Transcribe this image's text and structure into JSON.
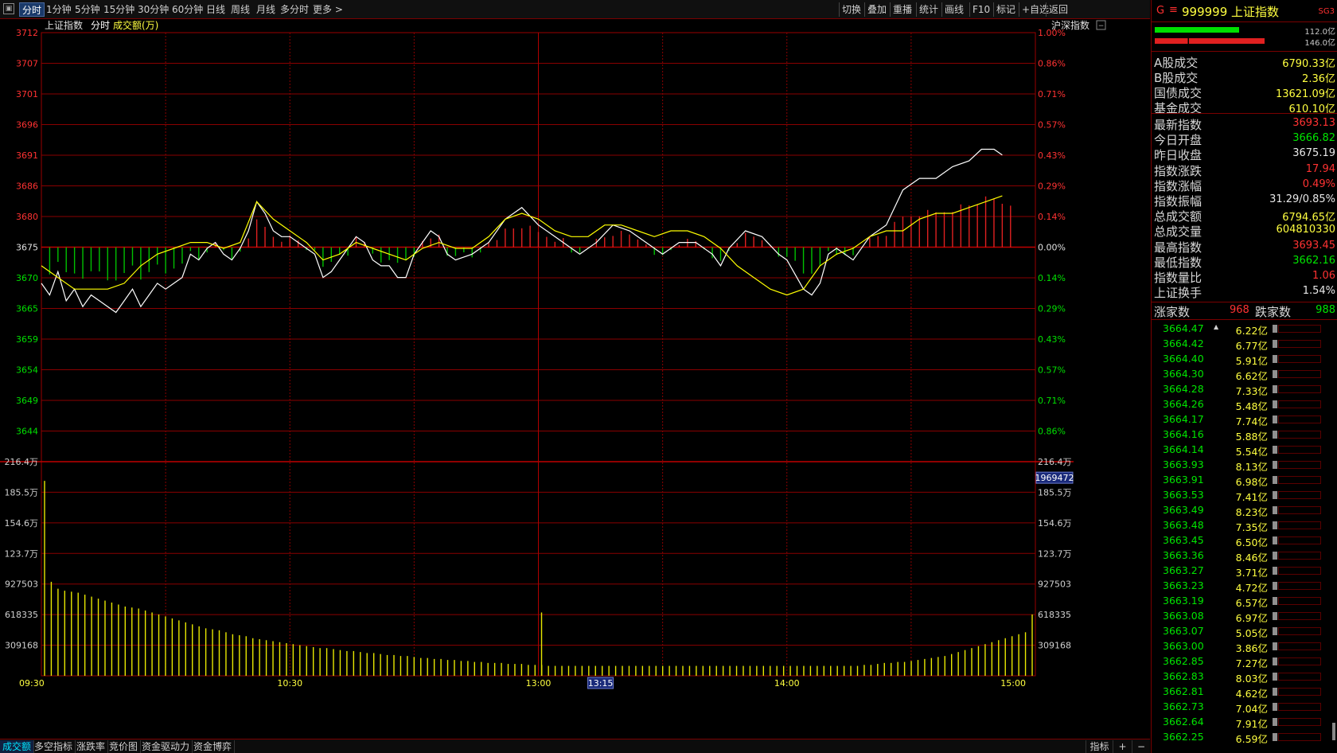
{
  "toolbar": {
    "periods": [
      "分时",
      "1分钟",
      "5分钟",
      "15分钟",
      "30分钟",
      "60分钟",
      "日线",
      "周线",
      "月线",
      "多分时",
      "更多 >"
    ],
    "active_period": "分时",
    "tools": [
      "切换",
      "叠加",
      "重播",
      "统计",
      "画线",
      "F10",
      "标记",
      "+自选",
      "返回"
    ]
  },
  "chart_header": {
    "index_name": "上证指数",
    "mode": "分时",
    "volume_label": "成交额(万)",
    "right_label": "沪深指数"
  },
  "chart_data": {
    "type": "line",
    "price_axis": {
      "left_ticks": [
        "3712",
        "3707",
        "3701",
        "3696",
        "3691",
        "3686",
        "3680",
        "3675",
        "3670",
        "3665",
        "3659",
        "3654",
        "3649",
        "3644"
      ],
      "right_ticks": [
        "1.00%",
        "0.86%",
        "0.71%",
        "0.57%",
        "0.43%",
        "0.29%",
        "0.14%",
        "0.00%",
        "0.14%",
        "0.29%",
        "0.43%",
        "0.57%",
        "0.71%",
        "0.86%"
      ],
      "ylim": [
        3638.4,
        3712
      ],
      "prev_close": 3675.19
    },
    "volume_axis": {
      "left_ticks": [
        "216.4万",
        "185.5万",
        "154.6万",
        "123.7万",
        "927503",
        "618335",
        "309168"
      ],
      "right_ticks": [
        "216.4万",
        "185.5万",
        "154.6万",
        "123.7万",
        "927503",
        "618335",
        "309168"
      ],
      "ylim": [
        0,
        2164000
      ],
      "cursor_value": "1969472"
    },
    "x_ticks": [
      "09:30",
      "10:30",
      "13:00",
      "13:15",
      "14:00",
      "15:00"
    ],
    "highlighted_x_tick": "13:15",
    "series": [
      {
        "color": "#ffffff",
        "points": [
          [
            0,
            3669
          ],
          [
            2,
            3667
          ],
          [
            4,
            3671
          ],
          [
            6,
            3666
          ],
          [
            8,
            3668
          ],
          [
            10,
            3665
          ],
          [
            12,
            3667
          ],
          [
            14,
            3666
          ],
          [
            16,
            3665
          ],
          [
            18,
            3664
          ],
          [
            20,
            3666
          ],
          [
            22,
            3668
          ],
          [
            24,
            3665
          ],
          [
            26,
            3667
          ],
          [
            28,
            3669
          ],
          [
            30,
            3668
          ],
          [
            32,
            3669
          ],
          [
            34,
            3670
          ],
          [
            36,
            3674
          ],
          [
            38,
            3673
          ],
          [
            40,
            3675
          ],
          [
            42,
            3676
          ],
          [
            44,
            3674
          ],
          [
            46,
            3673
          ],
          [
            48,
            3675
          ],
          [
            50,
            3678
          ],
          [
            52,
            3683
          ],
          [
            54,
            3681
          ],
          [
            56,
            3678
          ],
          [
            58,
            3677
          ],
          [
            60,
            3677
          ],
          [
            62,
            3676
          ],
          [
            64,
            3675
          ],
          [
            66,
            3674
          ],
          [
            68,
            3670
          ],
          [
            70,
            3671
          ],
          [
            72,
            3673
          ],
          [
            74,
            3675
          ],
          [
            76,
            3677
          ],
          [
            78,
            3676
          ],
          [
            80,
            3673
          ],
          [
            82,
            3672
          ],
          [
            84,
            3672
          ],
          [
            86,
            3670
          ],
          [
            88,
            3670
          ],
          [
            90,
            3674
          ],
          [
            92,
            3676
          ],
          [
            94,
            3678
          ],
          [
            96,
            3677
          ],
          [
            98,
            3674
          ],
          [
            100,
            3673
          ],
          [
            104,
            3674
          ],
          [
            108,
            3676
          ],
          [
            112,
            3680
          ],
          [
            116,
            3682
          ],
          [
            120,
            3679
          ],
          [
            124,
            3677
          ],
          [
            128,
            3675
          ],
          [
            130,
            3674
          ],
          [
            134,
            3676
          ],
          [
            138,
            3679
          ],
          [
            142,
            3678
          ],
          [
            146,
            3676
          ],
          [
            150,
            3674
          ],
          [
            154,
            3676
          ],
          [
            158,
            3676
          ],
          [
            162,
            3674
          ],
          [
            164,
            3672
          ],
          [
            166,
            3675
          ],
          [
            170,
            3678
          ],
          [
            174,
            3677
          ],
          [
            178,
            3674
          ],
          [
            180,
            3673
          ],
          [
            184,
            3668
          ],
          [
            186,
            3667
          ],
          [
            188,
            3669
          ],
          [
            190,
            3674
          ],
          [
            192,
            3675
          ],
          [
            196,
            3673
          ],
          [
            200,
            3677
          ],
          [
            204,
            3679
          ],
          [
            208,
            3685
          ],
          [
            212,
            3687
          ],
          [
            216,
            3687
          ],
          [
            220,
            3689
          ],
          [
            224,
            3690
          ],
          [
            227,
            3692
          ],
          [
            230,
            3692
          ],
          [
            232,
            3691
          ]
        ]
      },
      {
        "color": "#ffff00",
        "points": [
          [
            0,
            3672
          ],
          [
            4,
            3670
          ],
          [
            8,
            3668
          ],
          [
            12,
            3668
          ],
          [
            16,
            3668
          ],
          [
            20,
            3669
          ],
          [
            24,
            3672
          ],
          [
            28,
            3674
          ],
          [
            32,
            3675
          ],
          [
            36,
            3676
          ],
          [
            40,
            3676
          ],
          [
            44,
            3675
          ],
          [
            48,
            3676
          ],
          [
            52,
            3683
          ],
          [
            56,
            3680
          ],
          [
            60,
            3678
          ],
          [
            64,
            3676
          ],
          [
            68,
            3673
          ],
          [
            72,
            3674
          ],
          [
            76,
            3676
          ],
          [
            80,
            3675
          ],
          [
            84,
            3674
          ],
          [
            88,
            3673
          ],
          [
            92,
            3675
          ],
          [
            96,
            3676
          ],
          [
            100,
            3675
          ],
          [
            104,
            3675
          ],
          [
            108,
            3677
          ],
          [
            112,
            3680
          ],
          [
            116,
            3681
          ],
          [
            120,
            3680
          ],
          [
            124,
            3678
          ],
          [
            128,
            3677
          ],
          [
            132,
            3677
          ],
          [
            136,
            3679
          ],
          [
            140,
            3679
          ],
          [
            144,
            3678
          ],
          [
            148,
            3677
          ],
          [
            152,
            3678
          ],
          [
            156,
            3678
          ],
          [
            160,
            3677
          ],
          [
            164,
            3675
          ],
          [
            168,
            3672
          ],
          [
            172,
            3670
          ],
          [
            176,
            3668
          ],
          [
            180,
            3667
          ],
          [
            184,
            3668
          ],
          [
            188,
            3672
          ],
          [
            192,
            3674
          ],
          [
            196,
            3675
          ],
          [
            200,
            3677
          ],
          [
            204,
            3678
          ],
          [
            208,
            3678
          ],
          [
            212,
            3680
          ],
          [
            216,
            3681
          ],
          [
            220,
            3681
          ],
          [
            224,
            3682
          ],
          [
            228,
            3683
          ],
          [
            232,
            3684
          ]
        ]
      }
    ],
    "volume_bars": [
      1969472,
      950000,
      880000,
      860000,
      850000,
      840000,
      820000,
      800000,
      780000,
      760000,
      740000,
      720000,
      700000,
      690000,
      680000,
      660000,
      640000,
      620000,
      600000,
      580000,
      560000,
      540000,
      520000,
      500000,
      480000,
      470000,
      460000,
      440000,
      420000,
      410000,
      400000,
      380000,
      370000,
      360000,
      350000,
      340000,
      330000,
      320000,
      310000,
      300000,
      290000,
      280000,
      280000,
      270000,
      260000,
      250000,
      250000,
      240000,
      230000,
      230000,
      220000,
      210000,
      210000,
      200000,
      200000,
      190000,
      180000,
      180000,
      170000,
      170000,
      160000,
      160000,
      150000,
      150000,
      140000,
      140000,
      130000,
      130000,
      130000,
      120000,
      120000,
      120000,
      110000,
      110000,
      110000,
      100000,
      100000,
      100000,
      100000,
      100000,
      100000,
      100000,
      100000,
      100000,
      100000,
      100000,
      100000,
      100000,
      100000,
      100000,
      100000,
      100000,
      100000,
      100000,
      100000,
      100000,
      100000,
      100000,
      100000,
      100000,
      100000,
      100000,
      100000,
      100000,
      100000,
      100000,
      100000,
      100000,
      100000,
      100000,
      100000,
      100000,
      100000,
      100000,
      100000,
      100000,
      100000,
      100000,
      100000,
      100000,
      100000,
      100000,
      110000,
      110000,
      120000,
      130000,
      130000,
      140000,
      140000,
      150000,
      160000,
      170000,
      180000,
      190000,
      200000,
      220000,
      240000,
      260000,
      280000,
      300000,
      320000,
      340000,
      360000,
      380000,
      400000,
      420000,
      440000,
      620000
    ],
    "grid": true
  },
  "bottom_tabs": [
    "成交额",
    "多空指标",
    "涨跌率",
    "竞价图",
    "资金驱动力",
    "资金博弈"
  ],
  "active_bottom_tab": "成交额",
  "bottom_right": [
    "指标",
    "+",
    "−"
  ],
  "panel": {
    "market_flag": "G",
    "code": "999999",
    "name": "上证指数",
    "badge": "SG3",
    "strength_bars": [
      {
        "value": "112.0亿",
        "fill": 0.46,
        "color": "#00e000"
      },
      {
        "value": "146.0亿",
        "fill": 0.6,
        "color": "#e02020"
      }
    ],
    "turnover": [
      {
        "label": "A股成交",
        "value": "6790.33亿"
      },
      {
        "label": "B股成交",
        "value": "2.36亿"
      },
      {
        "label": "国债成交",
        "value": "13621.09亿"
      },
      {
        "label": "基金成交",
        "value": "610.10亿"
      }
    ],
    "stats": [
      {
        "label": "最新指数",
        "value": "3693.13",
        "color": "red"
      },
      {
        "label": "今日开盘",
        "value": "3666.82",
        "color": "green"
      },
      {
        "label": "昨日收盘",
        "value": "3675.19",
        "color": "white"
      },
      {
        "label": "指数涨跌",
        "value": "17.94",
        "color": "red"
      },
      {
        "label": "指数涨幅",
        "value": "0.49%",
        "color": "red"
      },
      {
        "label": "指数振幅",
        "value": "31.29/0.85%",
        "color": "white"
      },
      {
        "label": "总成交额",
        "value": "6794.65亿",
        "color": "yellow"
      },
      {
        "label": "总成交量",
        "value": "604810330",
        "color": "yellow"
      },
      {
        "label": "最高指数",
        "value": "3693.45",
        "color": "red"
      },
      {
        "label": "最低指数",
        "value": "3662.16",
        "color": "green"
      },
      {
        "label": "指数量比",
        "value": "1.06",
        "color": "red"
      },
      {
        "label": "上证换手",
        "value": "1.54%",
        "color": "white"
      }
    ],
    "up_label": "涨家数",
    "up_count": "968",
    "down_label": "跌家数",
    "down_count": "988",
    "ticks": [
      {
        "price": "3664.47",
        "amount": "6.22亿"
      },
      {
        "price": "3664.42",
        "amount": "6.77亿"
      },
      {
        "price": "3664.40",
        "amount": "5.91亿"
      },
      {
        "price": "3664.30",
        "amount": "6.62亿"
      },
      {
        "price": "3664.28",
        "amount": "7.33亿"
      },
      {
        "price": "3664.26",
        "amount": "5.48亿"
      },
      {
        "price": "3664.17",
        "amount": "7.74亿"
      },
      {
        "price": "3664.16",
        "amount": "5.88亿"
      },
      {
        "price": "3664.14",
        "amount": "5.54亿"
      },
      {
        "price": "3663.93",
        "amount": "8.13亿"
      },
      {
        "price": "3663.91",
        "amount": "6.98亿"
      },
      {
        "price": "3663.53",
        "amount": "7.41亿"
      },
      {
        "price": "3663.49",
        "amount": "8.23亿"
      },
      {
        "price": "3663.48",
        "amount": "7.35亿"
      },
      {
        "price": "3663.45",
        "amount": "6.50亿"
      },
      {
        "price": "3663.36",
        "amount": "8.46亿"
      },
      {
        "price": "3663.27",
        "amount": "3.71亿"
      },
      {
        "price": "3663.23",
        "amount": "4.72亿"
      },
      {
        "price": "3663.19",
        "amount": "6.57亿"
      },
      {
        "price": "3663.08",
        "amount": "6.97亿"
      },
      {
        "price": "3663.07",
        "amount": "5.05亿"
      },
      {
        "price": "3663.00",
        "amount": "3.86亿"
      },
      {
        "price": "3662.85",
        "amount": "7.27亿"
      },
      {
        "price": "3662.83",
        "amount": "8.03亿"
      },
      {
        "price": "3662.81",
        "amount": "4.62亿"
      },
      {
        "price": "3662.73",
        "amount": "7.04亿"
      },
      {
        "price": "3662.64",
        "amount": "7.91亿"
      },
      {
        "price": "3662.25",
        "amount": "6.59亿"
      }
    ]
  }
}
